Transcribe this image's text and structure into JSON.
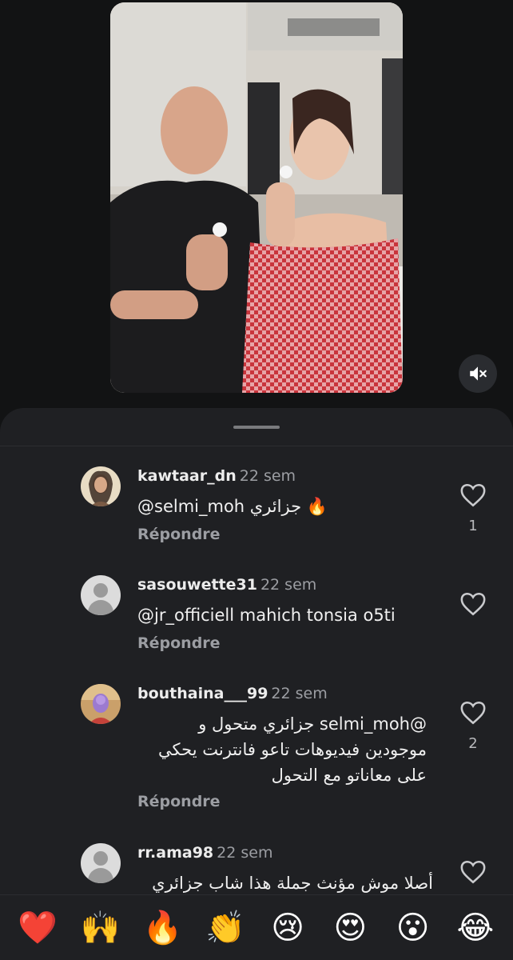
{
  "video": {
    "mute_icon": "volume-muted-icon"
  },
  "comments": [
    {
      "user": "kawtaar_dn",
      "time": "22 sem",
      "text": "@selmi_moh جزائري 🔥",
      "reply": "Répondre",
      "likes": "1",
      "avatar": "photo"
    },
    {
      "user": "sasouwette31",
      "time": "22 sem",
      "text": "@jr_officiell mahich tonsia o5ti",
      "reply": "Répondre",
      "likes": "",
      "avatar": "default"
    },
    {
      "user": "bouthaina___99",
      "time": "22 sem",
      "text": "@selmi_moh جزائري متحول و\nموجودين فيديوهات تاعو فانترنت يحكي\nعلى معاناتو مع التحول",
      "reply": "Répondre",
      "likes": "2",
      "avatar": "photo"
    },
    {
      "user": "rr.ama98",
      "time": "22 sem",
      "text": "أصلا موش مؤنث جملة هذا شاب جزائري",
      "reply": "",
      "likes": "",
      "avatar": "default"
    }
  ],
  "emoji_bar": [
    "❤️",
    "🙌",
    "🔥",
    "👏",
    "😢",
    "😍",
    "😮",
    "😂"
  ]
}
